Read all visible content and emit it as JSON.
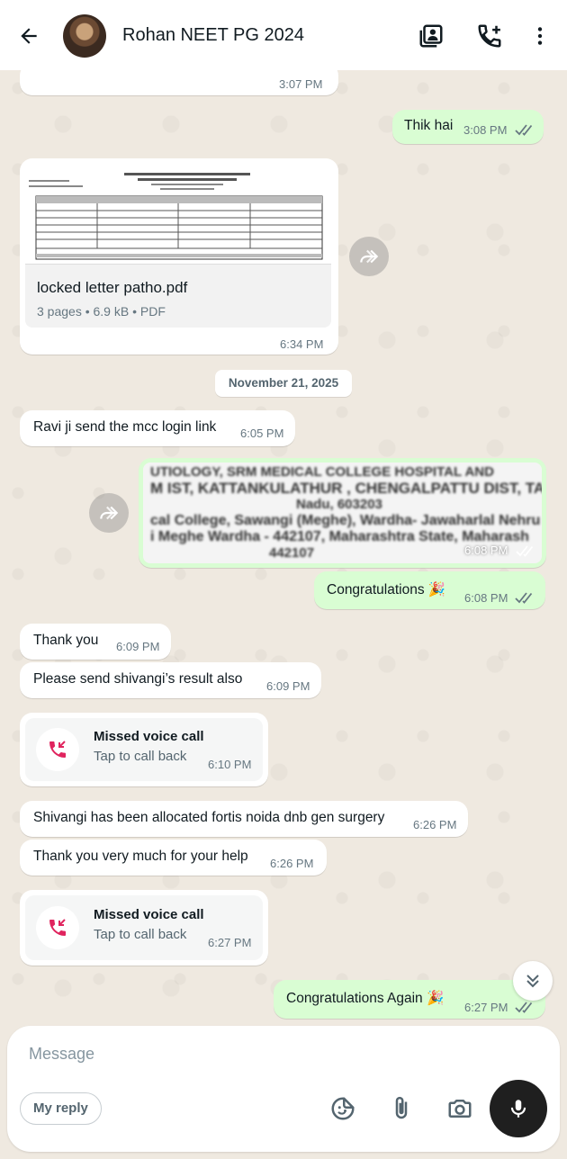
{
  "header": {
    "contact_name": "Rohan NEET PG 2024"
  },
  "date_chip": "November 21, 2025",
  "messages": {
    "m0": {
      "time": "3:07 PM"
    },
    "m1": {
      "text": "Thik hai",
      "time": "3:08 PM"
    },
    "m2": {
      "doc_name": "locked letter patho.pdf",
      "doc_meta": "3 pages • 6.9 kB • PDF",
      "time": "6:34 PM"
    },
    "m3": {
      "text": "Ravi ji send the mcc login link",
      "time": "6:05 PM"
    },
    "m4": {
      "image_lines": [
        "UTIOLOGY, SRM MEDICAL COLLEGE HOSPITAL AND",
        "M IST, KATTANKULATHUR , CHENGALPATTU DIST, TA",
        "Nadu, 603203",
        "cal College, Sawangi (Meghe), Wardha- Jawaharlal Nehru",
        "i Meghe Wardha - 442107, Maharashtra State, Maharash",
        "442107"
      ],
      "time": "6:08 PM"
    },
    "m5": {
      "text": "Congratulations 🎉",
      "time": "6:08 PM"
    },
    "m6": {
      "text": "Thank you",
      "time": "6:09 PM"
    },
    "m7": {
      "text": "Please send shivangi’s result also",
      "time": "6:09 PM"
    },
    "m8": {
      "title": "Missed voice call",
      "subtitle": "Tap to call back",
      "time": "6:10 PM"
    },
    "m9": {
      "text": "Shivangi has been allocated fortis noida dnb gen surgery",
      "time": "6:26 PM"
    },
    "m10": {
      "text": "Thank you very much for your help",
      "time": "6:26 PM"
    },
    "m11": {
      "title": "Missed voice call",
      "subtitle": "Tap to call back",
      "time": "6:27 PM"
    },
    "m12": {
      "text": "Congratulations Again 🎉",
      "time": "6:27 PM"
    }
  },
  "composer": {
    "placeholder": "Message",
    "reply_chip": "My reply"
  },
  "colors": {
    "outgoing_bubble": "#d9fdd3",
    "incoming_bubble": "#ffffff",
    "missed_call_red": "#e0245e",
    "read_tick": "#53bdeb"
  },
  "icons": [
    "back-arrow-icon",
    "contact-card-icon",
    "add-call-icon",
    "more-vert-icon",
    "forward-icon",
    "missed-call-icon",
    "double-tick-icon",
    "chevron-down-double-icon",
    "sticker-icon",
    "attach-icon",
    "camera-icon",
    "mic-icon"
  ]
}
